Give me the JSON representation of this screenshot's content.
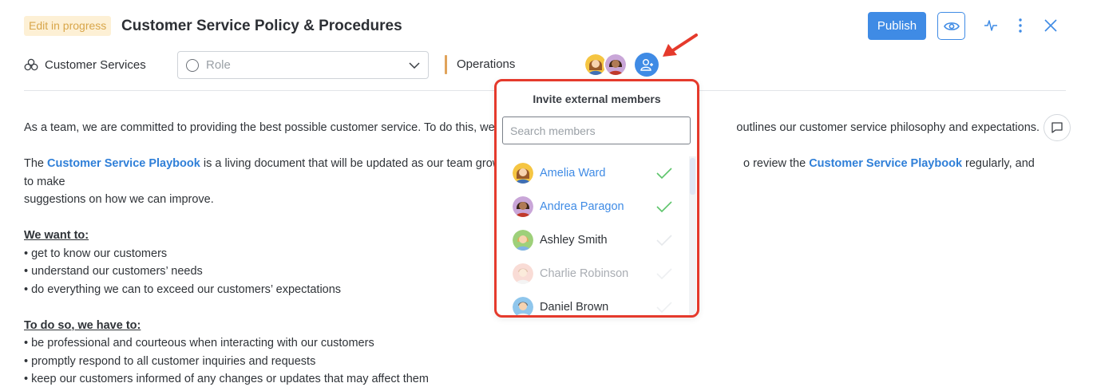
{
  "header": {
    "status_badge": "Edit in progress",
    "title": "Customer Service Policy & Procedures",
    "publish_label": "Publish",
    "icons": {
      "preview": "eye-icon",
      "activity": "activity-icon",
      "more": "more-vertical-icon",
      "close": "close-icon"
    }
  },
  "meta": {
    "team": "Customer Services",
    "team_icon": "team-icon",
    "role_placeholder": "Role",
    "department": "Operations",
    "department_color": "#e0a35a"
  },
  "invite_panel": {
    "title": "Invite external members",
    "search_placeholder": "Search members",
    "search_value": "",
    "members": [
      {
        "name": "Amelia Ward",
        "selected": true
      },
      {
        "name": "Andrea Paragon",
        "selected": true
      },
      {
        "name": "Ashley Smith",
        "selected": false
      },
      {
        "name": "Charlie Robinson",
        "selected": false
      },
      {
        "name": "Daniel Brown",
        "selected": false
      }
    ]
  },
  "content": {
    "p1": "As a team, we are committed to providing the best possible customer service. To do this, we have c",
    "p1_end": "outlines our customer service philosophy and expectations.",
    "p2_start": "The ",
    "p2_link": "Customer Service Playbook",
    "p2_mid": " is a living document that will be updated as our team grows and c",
    "p2_mid2": "o review the ",
    "p2_link2": "Customer Service Playbook",
    "p2_end": " regularly, and to make",
    "p2_line2": "suggestions on how we can improve.",
    "want_heading": "We want to:",
    "want_items": [
      "• get to know our customers",
      "• understand our customers’ needs",
      "• do everything we can to exceed our customers’ expectations"
    ],
    "todo_heading": "To do so, we have to:",
    "todo_items": [
      "• be professional and courteous when interacting with our customers",
      "• promptly respond to all customer inquiries and requests",
      "• keep our customers informed of any changes or updates that may affect them"
    ]
  },
  "colors": {
    "accent": "#3f8be5",
    "highlight_border": "#e53a2c",
    "check": "#5cc46a"
  }
}
